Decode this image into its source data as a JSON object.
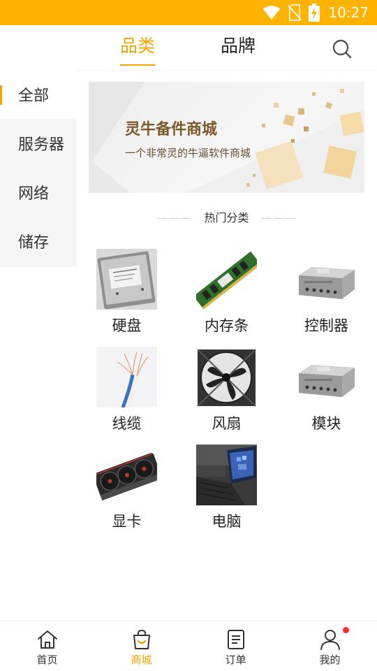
{
  "status_bar": {
    "time": "10:27",
    "icons": [
      "wifi-icon",
      "no-sim-icon",
      "battery-charging-icon"
    ]
  },
  "top_tabs": [
    {
      "label": "品类",
      "active": true
    },
    {
      "label": "品牌",
      "active": false
    }
  ],
  "search": {
    "icon": "search-icon"
  },
  "sidebar": {
    "items": [
      {
        "label": "全部",
        "active": true
      },
      {
        "label": "服务器",
        "active": false
      },
      {
        "label": "网络",
        "active": false
      },
      {
        "label": "储存",
        "active": false
      }
    ]
  },
  "banner": {
    "title": "灵牛备件商城",
    "subtitle": "一个非常灵的牛逼软件商城"
  },
  "section": {
    "title": "热门分类"
  },
  "categories": [
    {
      "label": "硬盘",
      "image": "hard-drive"
    },
    {
      "label": "内存条",
      "image": "memory-stick"
    },
    {
      "label": "控制器",
      "image": "controller"
    },
    {
      "label": "线缆",
      "image": "cable"
    },
    {
      "label": "风扇",
      "image": "fan"
    },
    {
      "label": "模块",
      "image": "module"
    },
    {
      "label": "显卡",
      "image": "graphics-card"
    },
    {
      "label": "电脑",
      "image": "laptop"
    }
  ],
  "bottom_nav": [
    {
      "label": "首页",
      "icon": "home-icon",
      "active": false
    },
    {
      "label": "商城",
      "icon": "shopping-bag-icon",
      "active": true
    },
    {
      "label": "订单",
      "icon": "order-list-icon",
      "active": false
    },
    {
      "label": "我的",
      "icon": "user-icon",
      "active": false,
      "badge": true
    }
  ],
  "colors": {
    "status_bar": "#ffb300",
    "accent": "#f5a300",
    "badge": "#ff2a2a"
  }
}
